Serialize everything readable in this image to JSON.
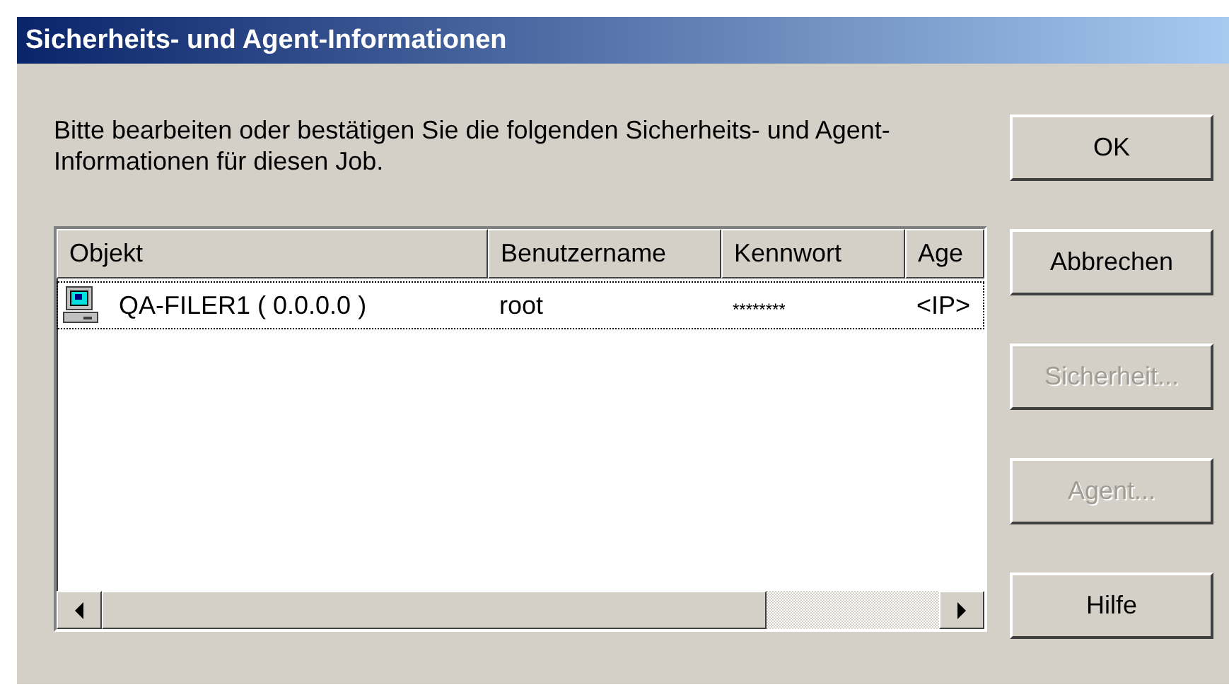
{
  "window": {
    "title": "Sicherheits- und Agent-Informationen"
  },
  "message": "Bitte bearbeiten oder bestätigen Sie die folgenden Sicherheits- und Agent-Informationen für diesen Job.",
  "list": {
    "columns": [
      "Objekt",
      "Benutzername",
      "Kennwort",
      "Age"
    ],
    "rows": [
      {
        "cells": [
          "QA-FILER1 ( 0.0.0.0 )",
          "root",
          "********",
          "<IP>"
        ],
        "focused": true
      }
    ]
  },
  "buttons": [
    {
      "label": "OK",
      "disabled": false
    },
    {
      "label": "Abbrechen",
      "disabled": false
    },
    {
      "label": "Sicherheit...",
      "disabled": true
    },
    {
      "label": "Agent...",
      "disabled": true
    },
    {
      "label": "Hilfe",
      "disabled": false
    }
  ]
}
